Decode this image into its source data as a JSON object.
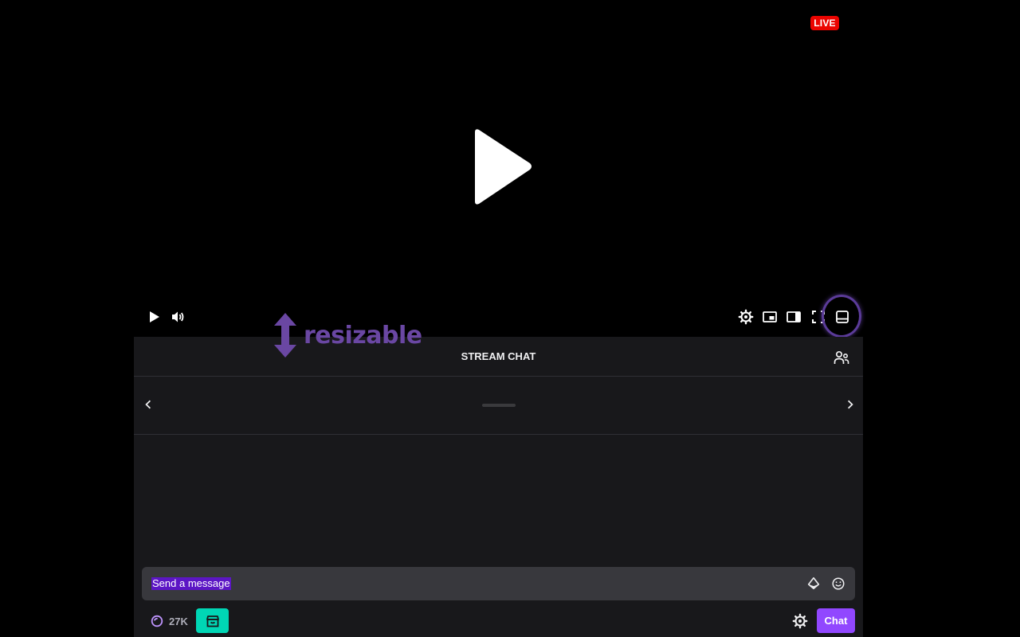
{
  "player": {
    "live_badge": "LIVE",
    "icons": {
      "big_play": "play-icon",
      "play": "play-icon",
      "volume": "volume-icon",
      "settings": "gear-icon",
      "mini_player": "picture-in-picture-icon",
      "theatre": "sidebar-layout-icon",
      "fullscreen": "fullscreen-icon",
      "chat_below": "bottom-panel-layout-icon"
    }
  },
  "annotation": {
    "label": "resizable",
    "color": "#6a47a3"
  },
  "chat": {
    "title": "STREAM CHAT",
    "input_placeholder": "Send a message",
    "points": "27K",
    "send_label": "Chat",
    "colors": {
      "accent": "#9147ff",
      "store": "#00d6b5",
      "live": "#eb0400",
      "panel": "#18181b"
    }
  }
}
